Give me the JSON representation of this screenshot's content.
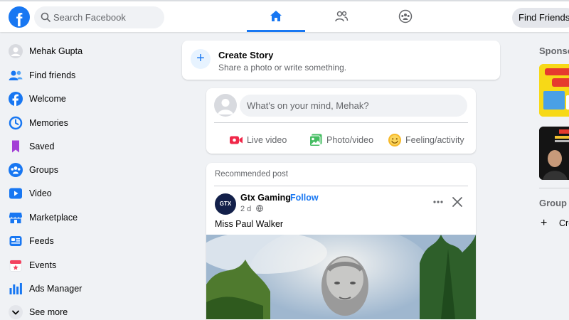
{
  "header": {
    "logo": "facebook-logo",
    "search_placeholder": "Search Facebook",
    "nav": [
      {
        "name": "home",
        "icon": "home-icon",
        "active": true
      },
      {
        "name": "friends",
        "icon": "friends-icon",
        "active": false
      },
      {
        "name": "groups",
        "icon": "groups-icon",
        "active": false
      }
    ],
    "find_friends_label": "Find Friends"
  },
  "sidebar": {
    "items": [
      {
        "label": "Mehak Gupta",
        "icon": "avatar-icon"
      },
      {
        "label": "Find friends",
        "icon": "friends-icon"
      },
      {
        "label": "Welcome",
        "icon": "facebook-icon"
      },
      {
        "label": "Memories",
        "icon": "clock-icon"
      },
      {
        "label": "Saved",
        "icon": "bookmark-icon"
      },
      {
        "label": "Groups",
        "icon": "groups-icon"
      },
      {
        "label": "Video",
        "icon": "video-icon"
      },
      {
        "label": "Marketplace",
        "icon": "marketplace-icon"
      },
      {
        "label": "Feeds",
        "icon": "feeds-icon"
      },
      {
        "label": "Events",
        "icon": "calendar-icon"
      },
      {
        "label": "Ads Manager",
        "icon": "bar-chart-icon"
      },
      {
        "label": "See more",
        "icon": "chevron-down-icon"
      }
    ]
  },
  "create_story": {
    "title": "Create Story",
    "subtitle": "Share a photo or write something."
  },
  "composer": {
    "placeholder": "What's on your mind, Mehak?",
    "actions": [
      {
        "label": "Live video",
        "icon": "live-video-icon",
        "color": "#f02849"
      },
      {
        "label": "Photo/video",
        "icon": "photo-icon",
        "color": "#45bd62"
      },
      {
        "label": "Feeling/activity",
        "icon": "feeling-icon",
        "color": "#f7b928"
      }
    ]
  },
  "post": {
    "section_label": "Recommended post",
    "author": "Gtx Gaming",
    "separator": "·",
    "follow_label": "Follow",
    "time": "2 d",
    "text": "Miss Paul Walker"
  },
  "right": {
    "sponsored_heading": "Sponso",
    "group_heading": "Group c",
    "create_label": "Cre"
  },
  "colors": {
    "brand": "#1877f2",
    "background": "#f0f2f5",
    "text_secondary": "#65676b"
  }
}
